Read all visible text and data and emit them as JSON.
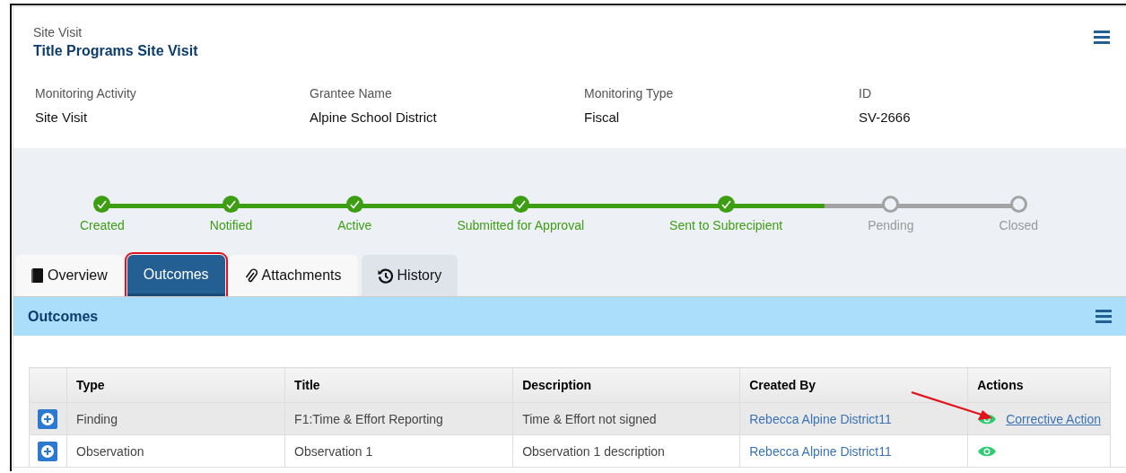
{
  "header": {
    "subtitle": "Site Visit",
    "title": "Title Programs Site Visit"
  },
  "fields": [
    {
      "label": "Monitoring Activity",
      "value": "Site Visit"
    },
    {
      "label": "Grantee Name",
      "value": "Alpine School District"
    },
    {
      "label": "Monitoring Type",
      "value": "Fiscal"
    },
    {
      "label": "ID",
      "value": "SV-2666"
    }
  ],
  "steps": [
    {
      "label": "Created",
      "completed": true
    },
    {
      "label": "Notified",
      "completed": true
    },
    {
      "label": "Active",
      "completed": true
    },
    {
      "label": "Submitted for Approval",
      "completed": true
    },
    {
      "label": "Sent to Subrecipient",
      "completed": true
    },
    {
      "label": "Pending",
      "completed": false
    },
    {
      "label": "Closed",
      "completed": false
    }
  ],
  "tabs": [
    {
      "label": "Overview",
      "kind": "book",
      "selected": false,
      "hovered": false,
      "highlighted": false
    },
    {
      "label": "Outcomes",
      "kind": "none",
      "selected": true,
      "hovered": false,
      "highlighted": true
    },
    {
      "label": "Attachments",
      "kind": "paperclip",
      "selected": false,
      "hovered": false,
      "highlighted": false
    },
    {
      "label": "History",
      "kind": "history",
      "selected": false,
      "hovered": true,
      "highlighted": false
    }
  ],
  "panel": {
    "title": "Outcomes"
  },
  "table": {
    "columns": [
      "Type",
      "Title",
      "Description",
      "Created By",
      "Actions"
    ],
    "rows": [
      {
        "type": "Finding",
        "title": "F1:Time & Effort Reporting",
        "description": "Time & Effort not signed",
        "created_by": "Rebecca Alpine District11",
        "action_link": "Corrective Action",
        "highlighted": true,
        "arrow": true
      },
      {
        "type": "Observation",
        "title": "Observation 1",
        "description": "Observation 1 description",
        "created_by": "Rebecca Alpine District11",
        "highlighted": false,
        "arrow": false
      }
    ]
  }
}
